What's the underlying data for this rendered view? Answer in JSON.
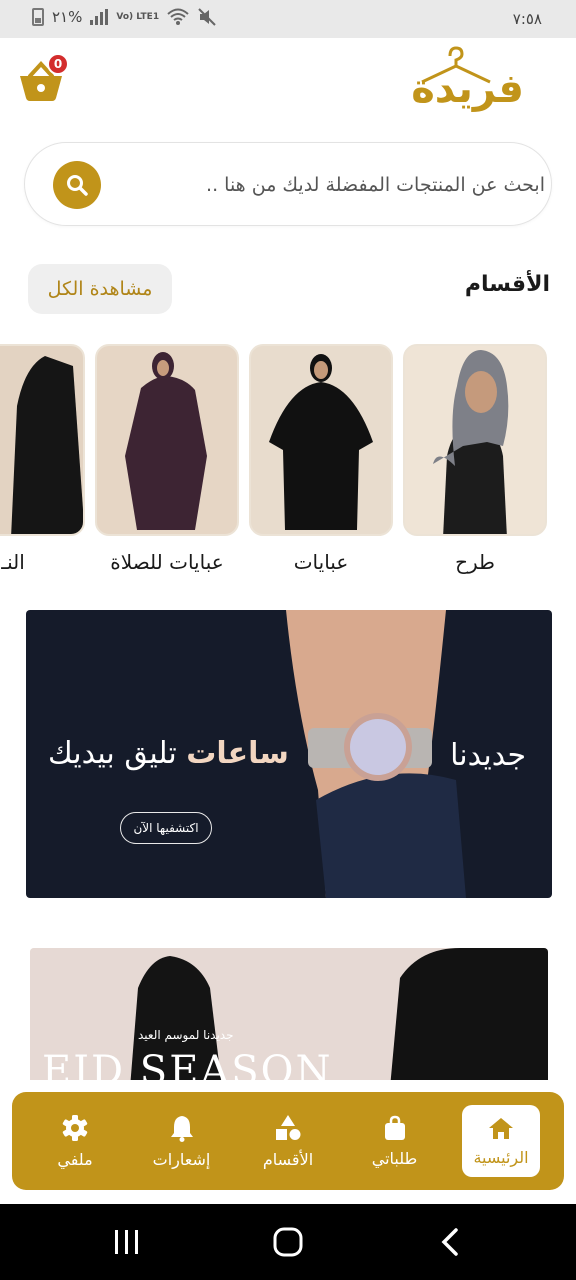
{
  "status_bar": {
    "time": "٧:٥٨",
    "battery": "٢١%",
    "network": "Vo) LTE1"
  },
  "header": {
    "logo_text": "فريدة",
    "cart_count": "0"
  },
  "search": {
    "placeholder": "ابحث عن المنتجات المفضلة لديك من هنا .."
  },
  "categories_section": {
    "title": "الأقسام",
    "view_all": "مشاهدة الكل",
    "items": [
      {
        "label": "طرح"
      },
      {
        "label": "عبايات"
      },
      {
        "label": "عبايات للصلاة"
      },
      {
        "label": "النـ"
      }
    ]
  },
  "banner_watches": {
    "new_label": "جديدنا",
    "headline_bold": "ساعات",
    "headline_rest": "تليق بيديك",
    "cta": "اكتشفيها الآن"
  },
  "banner_eid": {
    "subtitle": "جديدنا لموسم العيد",
    "title": "EID SEASON"
  },
  "bottom_nav": {
    "items": [
      {
        "label": "الرئيسية",
        "icon": "home-icon",
        "active": true
      },
      {
        "label": "طلباتي",
        "icon": "bag-icon",
        "active": false
      },
      {
        "label": "الأقسام",
        "icon": "shapes-icon",
        "active": false
      },
      {
        "label": "إشعارات",
        "icon": "bell-icon",
        "active": false
      },
      {
        "label": "ملفي",
        "icon": "gear-icon",
        "active": false
      }
    ]
  },
  "colors": {
    "accent": "#c1941a",
    "badge": "#d32d2d",
    "banner_dark": "#151b2a"
  }
}
